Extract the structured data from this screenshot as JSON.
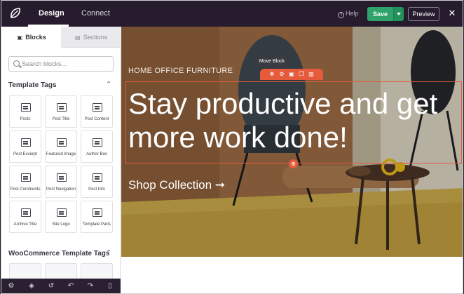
{
  "header": {
    "tabs": [
      {
        "label": "Design",
        "active": true
      },
      {
        "label": "Connect",
        "active": false
      }
    ],
    "help_label": "Help",
    "save_label": "Save",
    "preview_label": "Preview",
    "icons": {
      "logo": "seedprod-leaf-logo",
      "close": "close-icon",
      "help": "help-circle-icon",
      "dropdown": "chevron-down-icon"
    }
  },
  "sidebar": {
    "tabs": [
      {
        "label": "Blocks",
        "active": true
      },
      {
        "label": "Sections",
        "active": false
      }
    ],
    "search": {
      "placeholder": "Search blocks...",
      "value": ""
    },
    "categories": [
      {
        "title": "Template Tags",
        "items": [
          "Posts",
          "Post Title",
          "Post Content",
          "Post Excerpt",
          "Featured Image",
          "Author Box",
          "Post Comments",
          "Post Navigation",
          "Post Info",
          "Archive Title",
          "Site Logo",
          "Template Parts"
        ]
      },
      {
        "title": "WooCommerce Template Tags",
        "items": []
      }
    ]
  },
  "bottombar": {
    "icons": [
      "settings-icon",
      "layers-icon",
      "history-icon",
      "undo-icon",
      "redo-icon",
      "mobile-preview-icon"
    ]
  },
  "canvas": {
    "kicker": "HOME OFFICE FURNITURE",
    "headline": "Stay productive and get more work done!",
    "cta": "Shop Collection ➞",
    "tooltip": "Move Block",
    "toolbar_icons": [
      "move-icon",
      "settings-icon",
      "save-icon",
      "duplicate-icon",
      "delete-icon"
    ],
    "colors": {
      "accent": "#e55b3c",
      "save": "#2fa36b",
      "topbar": "#261c2d"
    }
  }
}
